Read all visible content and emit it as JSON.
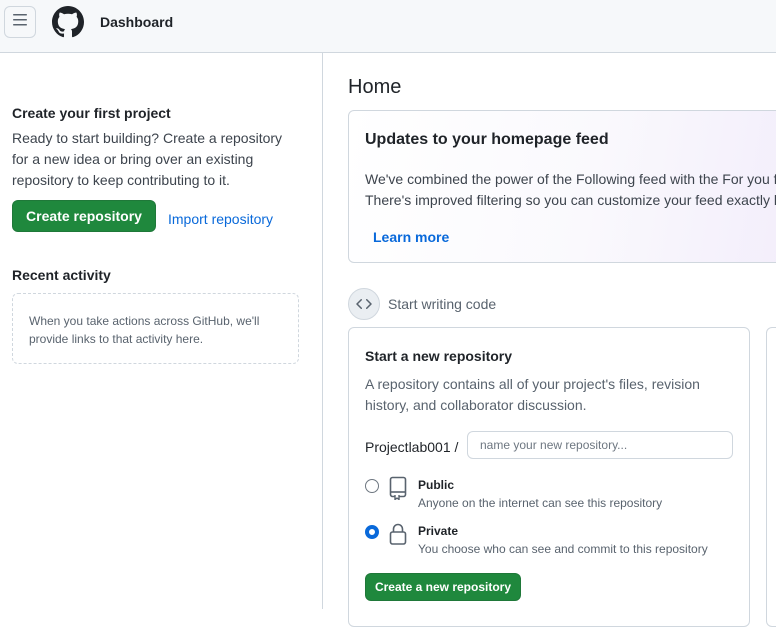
{
  "header": {
    "title": "Dashboard",
    "menu_icon": "hamburger-icon",
    "logo_icon": "github-logo"
  },
  "left": {
    "first_project": {
      "title": "Create your first project",
      "description": "Ready to start building? Create a repository for a new idea or bring over an existing repository to keep contributing to it.",
      "create_button": "Create repository",
      "import_link": "Import repository"
    },
    "recent_activity": {
      "title": "Recent activity",
      "empty_text": "When you take actions across GitHub, we'll provide links to that activity here."
    }
  },
  "main": {
    "title": "Home",
    "updates": {
      "title": "Updates to your homepage feed",
      "line1": "We've combined the power of the Following feed with the For you feed so there's one place to discover content on GitHub.",
      "line2": "There's improved filtering so you can customize your feed exactly how you like it.",
      "learn_more": "Learn more"
    },
    "start_writing": {
      "label": "Start writing code",
      "icon": "code-icon"
    },
    "new_repo": {
      "title": "Start a new repository",
      "description": "A repository contains all of your project's files, revision history, and collaborator discussion.",
      "owner": "Projectlab001 /",
      "name_placeholder": "name your new repository...",
      "name_value": "",
      "options": [
        {
          "label": "Public",
          "description": "Anyone on the internet can see this repository",
          "icon": "repo-icon",
          "selected": false
        },
        {
          "label": "Private",
          "description": "You choose who can see and commit to this repository",
          "icon": "lock-icon",
          "selected": true
        }
      ],
      "create_button": "Create a new repository"
    }
  },
  "colors": {
    "primary_green": "#1f883d",
    "link_blue": "#0969da",
    "border": "#d0d7de"
  }
}
